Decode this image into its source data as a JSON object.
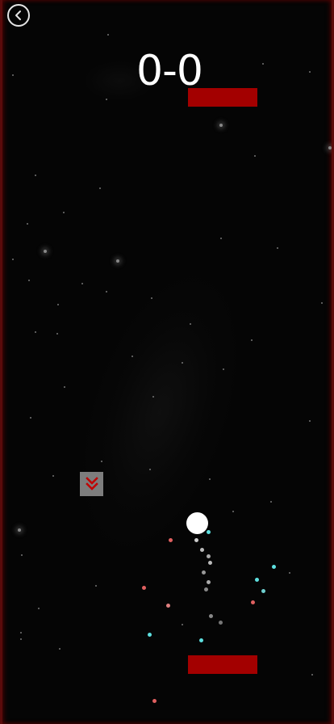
{
  "game": {
    "score": "0-0",
    "score_left": 0,
    "score_right": 0
  },
  "icons": {
    "back": "back-chevron-icon",
    "powerup": "double-chevron-down-icon"
  },
  "colors": {
    "background": "#000000",
    "paddle": "#a30000",
    "ball": "#ffffff",
    "powerup": "#7d7d7d",
    "powerup_arrow": "#c00000",
    "border": "#5a0b0b"
  }
}
